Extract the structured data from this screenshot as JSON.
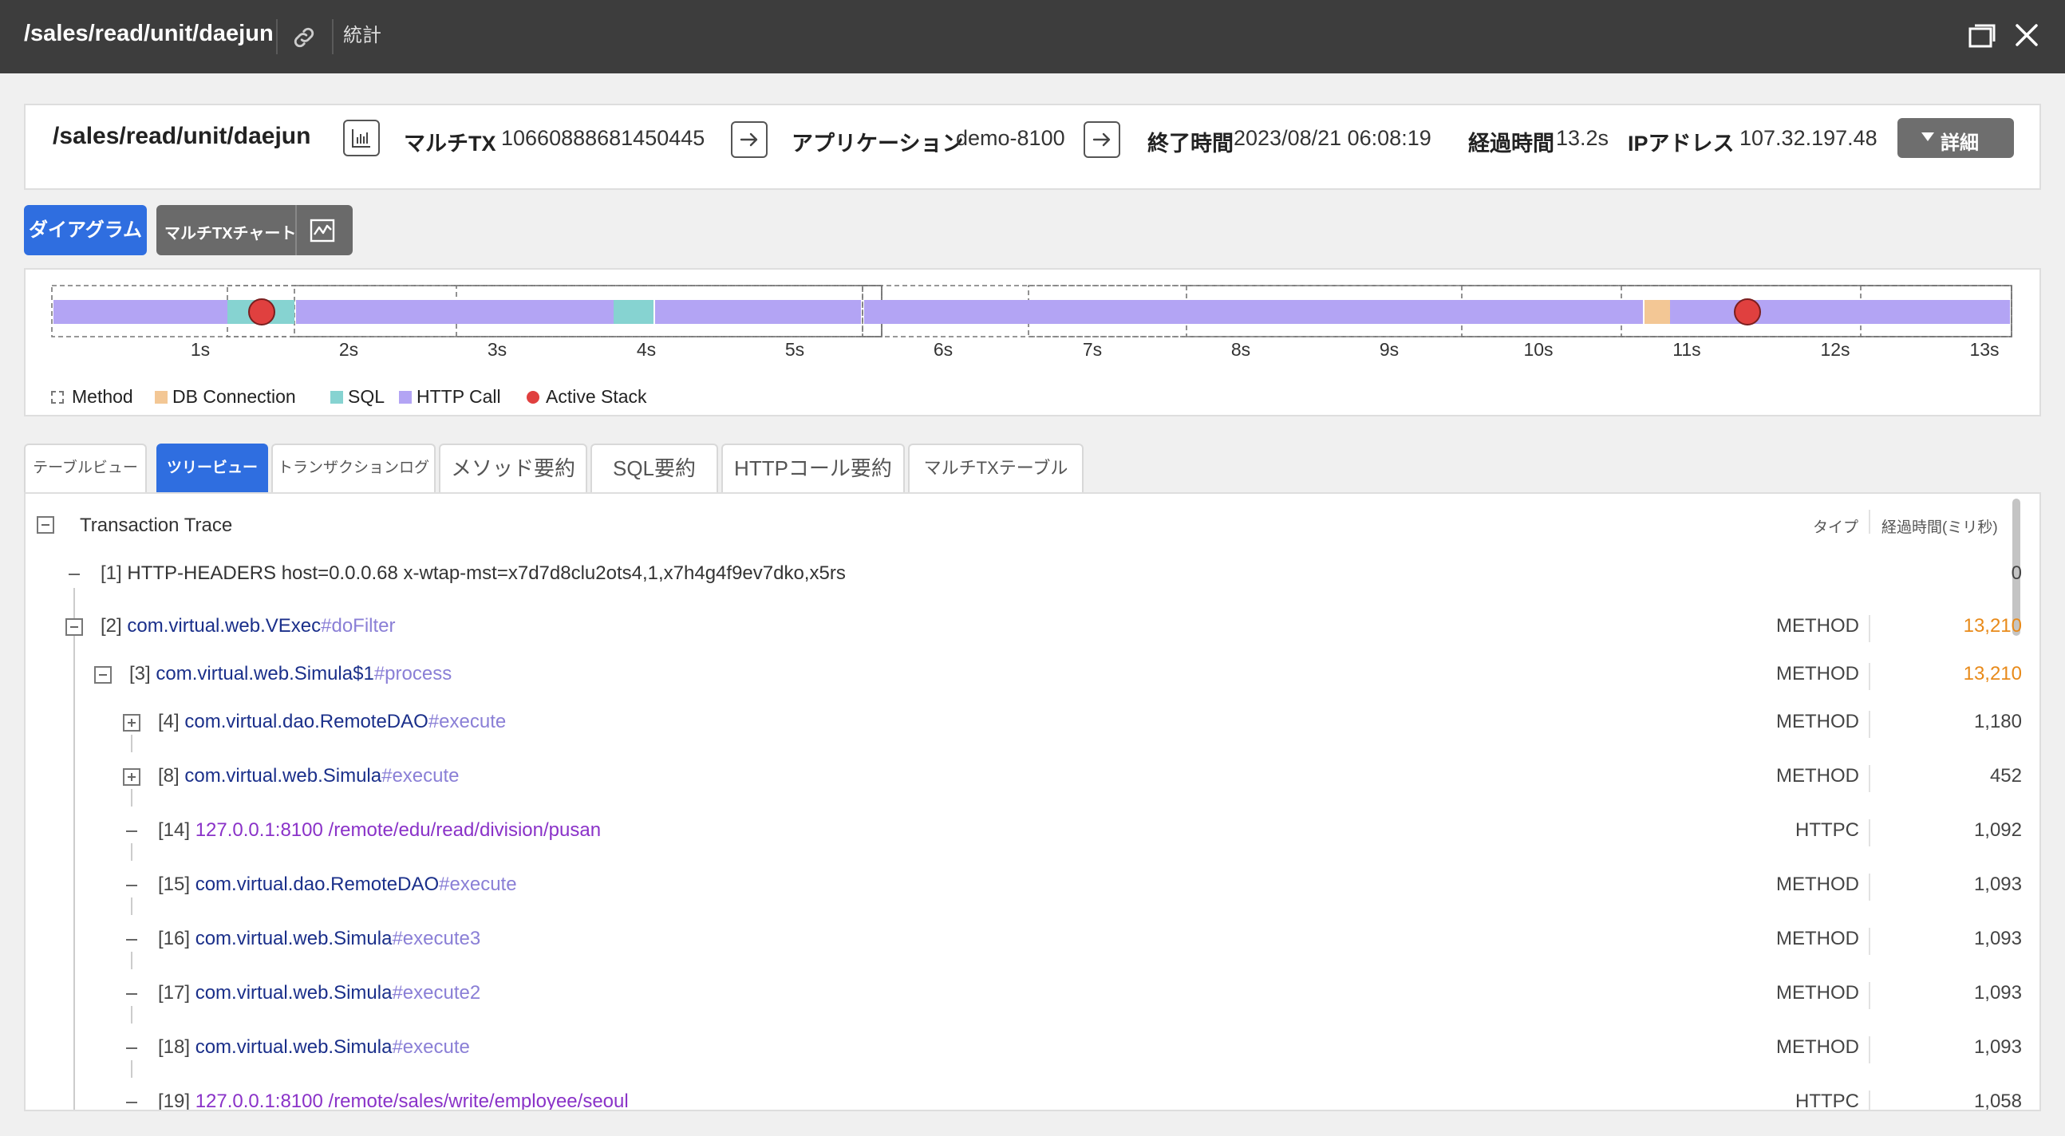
{
  "titlebar": {
    "path": "/sales/read/unit/daejun",
    "stats_label": "統計"
  },
  "summary": {
    "path": "/sales/read/unit/daejun",
    "multitx_label": "マルチTX",
    "multitx_value": "10660888681450445",
    "app_label": "アプリケーション",
    "app_value": "demo-8100",
    "end_label": "終了時間",
    "end_value": "2023/08/21 06:08:19",
    "elapsed_label": "経過時間",
    "elapsed_value": "13.2s",
    "ip_label": "IPアドレス",
    "ip_value": "107.32.197.48",
    "detail_button": "詳細"
  },
  "chart_buttons": {
    "diagram": "ダイアグラム",
    "multitx_chart": "マルチTXチャート"
  },
  "timeline": {
    "ticks": [
      "1s",
      "2s",
      "3s",
      "4s",
      "5s",
      "6s",
      "7s",
      "8s",
      "9s",
      "10s",
      "11s",
      "12s",
      "13s"
    ],
    "legend": {
      "method": "Method",
      "db": "DB Connection",
      "sql": "SQL",
      "http": "HTTP Call",
      "active": "Active Stack"
    },
    "colors": {
      "http": "#b3a4f4",
      "sql": "#86d3d1",
      "db": "#f3c795",
      "active": "#e0403f"
    }
  },
  "tabs": [
    {
      "label": "テーブルビュー",
      "active": false
    },
    {
      "label": "ツリービュー",
      "active": true
    },
    {
      "label": "トランザクションログ",
      "active": false
    },
    {
      "label": "メソッド要約",
      "active": false
    },
    {
      "label": "SQL要約",
      "active": false
    },
    {
      "label": "HTTPコール要約",
      "active": false
    },
    {
      "label": "マルチTXテーブル",
      "active": false
    }
  ],
  "tree": {
    "title": "Transaction Trace",
    "col_type": "タイプ",
    "col_time": "経過時間(ミリ秒)",
    "rows": [
      {
        "idx": "[1]",
        "text": "HTTP-HEADERS host=0.0.0.68 x-wtap-mst=x7d7d8clu2ots4,1,x7h4g4f9ev7dko,x5rs",
        "type": "",
        "time": "0"
      },
      {
        "idx": "[2]",
        "cls": "com.virtual.web.VExec",
        "method": "#doFilter",
        "type": "METHOD",
        "time": "13,210"
      },
      {
        "idx": "[3]",
        "cls": "com.virtual.web.Simula$1",
        "method": "#process",
        "type": "METHOD",
        "time": "13,210"
      },
      {
        "idx": "[4]",
        "cls": "com.virtual.dao.RemoteDAO",
        "method": "#execute",
        "type": "METHOD",
        "time": "1,180"
      },
      {
        "idx": "[8]",
        "cls": "com.virtual.web.Simula",
        "method": "#execute",
        "type": "METHOD",
        "time": "452"
      },
      {
        "idx": "[14]",
        "url": "127.0.0.1:8100 /remote/edu/read/division/pusan",
        "type": "HTTPC",
        "time": "1,092"
      },
      {
        "idx": "[15]",
        "cls": "com.virtual.dao.RemoteDAO",
        "method": "#execute",
        "type": "METHOD",
        "time": "1,093"
      },
      {
        "idx": "[16]",
        "cls": "com.virtual.web.Simula",
        "method": "#execute3",
        "type": "METHOD",
        "time": "1,093"
      },
      {
        "idx": "[17]",
        "cls": "com.virtual.web.Simula",
        "method": "#execute2",
        "type": "METHOD",
        "time": "1,093"
      },
      {
        "idx": "[18]",
        "cls": "com.virtual.web.Simula",
        "method": "#execute",
        "type": "METHOD",
        "time": "1,093"
      },
      {
        "idx": "[19]",
        "url": "127.0.0.1:8100 /remote/sales/write/employee/seoul",
        "type": "HTTPC",
        "time": "1,058"
      }
    ]
  }
}
